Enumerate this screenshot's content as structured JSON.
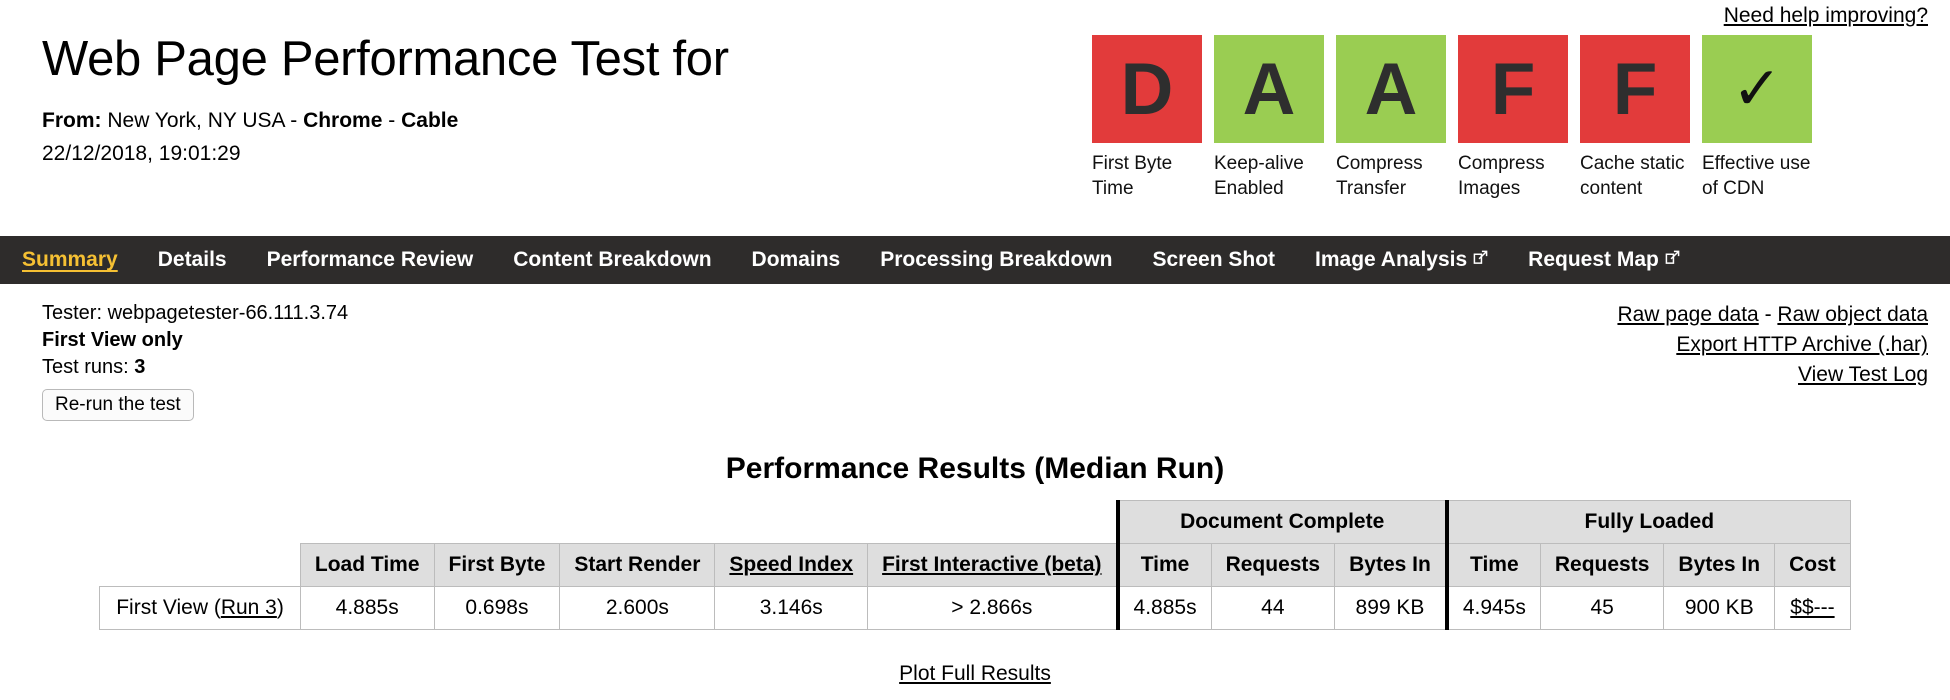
{
  "header": {
    "title": "Web Page Performance Test for",
    "from_label": "From:",
    "from_location": "New York, NY USA",
    "dash1": " - ",
    "browser": "Chrome",
    "dash2": " - ",
    "connection": "Cable",
    "timestamp": "22/12/2018, 19:01:29",
    "help_link": "Need help improving?"
  },
  "grades": [
    {
      "grade": "D",
      "label": "First Byte Time",
      "color": "#e23b3b"
    },
    {
      "grade": "A",
      "label": "Keep-alive Enabled",
      "color": "#9acd52"
    },
    {
      "grade": "A",
      "label": "Compress Transfer",
      "color": "#9acd52"
    },
    {
      "grade": "F",
      "label": "Compress Images",
      "color": "#e23b3b"
    },
    {
      "grade": "F",
      "label": "Cache static content",
      "color": "#e23b3b"
    },
    {
      "grade": "✓",
      "label": "Effective use of CDN",
      "color": "#9acd52"
    }
  ],
  "nav": {
    "active_color": "#f5c033",
    "background": "#2e2c2b",
    "items": [
      {
        "label": "Summary",
        "active": true,
        "external": false
      },
      {
        "label": "Details",
        "active": false,
        "external": false
      },
      {
        "label": "Performance Review",
        "active": false,
        "external": false
      },
      {
        "label": "Content Breakdown",
        "active": false,
        "external": false
      },
      {
        "label": "Domains",
        "active": false,
        "external": false
      },
      {
        "label": "Processing Breakdown",
        "active": false,
        "external": false
      },
      {
        "label": "Screen Shot",
        "active": false,
        "external": false
      },
      {
        "label": "Image Analysis",
        "active": false,
        "external": true
      },
      {
        "label": "Request Map",
        "active": false,
        "external": true
      }
    ]
  },
  "info": {
    "tester": "Tester: webpagetester-66.111.3.74",
    "view_mode": "First View only",
    "test_runs_label": "Test runs:",
    "test_runs_value": "3",
    "rerun_button": "Re-run the test",
    "links": {
      "raw_page_data": "Raw page data",
      "separator": " - ",
      "raw_object_data": "Raw object data",
      "export_har": "Export HTTP Archive (.har)",
      "view_test_log": "View Test Log"
    }
  },
  "results": {
    "title": "Performance Results (Median Run)",
    "group_headers": {
      "document_complete": "Document Complete",
      "fully_loaded": "Fully Loaded"
    },
    "columns": [
      "Load Time",
      "First Byte",
      "Start Render",
      "Speed Index",
      "First Interactive (beta)",
      "Time",
      "Requests",
      "Bytes In",
      "Time",
      "Requests",
      "Bytes In",
      "Cost"
    ],
    "row": {
      "label_prefix": "First View (",
      "label_link": "Run 3",
      "label_suffix": ")",
      "load_time": "4.885s",
      "first_byte": "0.698s",
      "start_render": "2.600s",
      "speed_index": "3.146s",
      "first_interactive": "> 2.866s",
      "dc_time": "4.885s",
      "dc_requests": "44",
      "dc_bytes_in": "899 KB",
      "fl_time": "4.945s",
      "fl_requests": "45",
      "fl_bytes_in": "900 KB",
      "cost": "$$---"
    },
    "plot_link": "Plot Full Results"
  }
}
